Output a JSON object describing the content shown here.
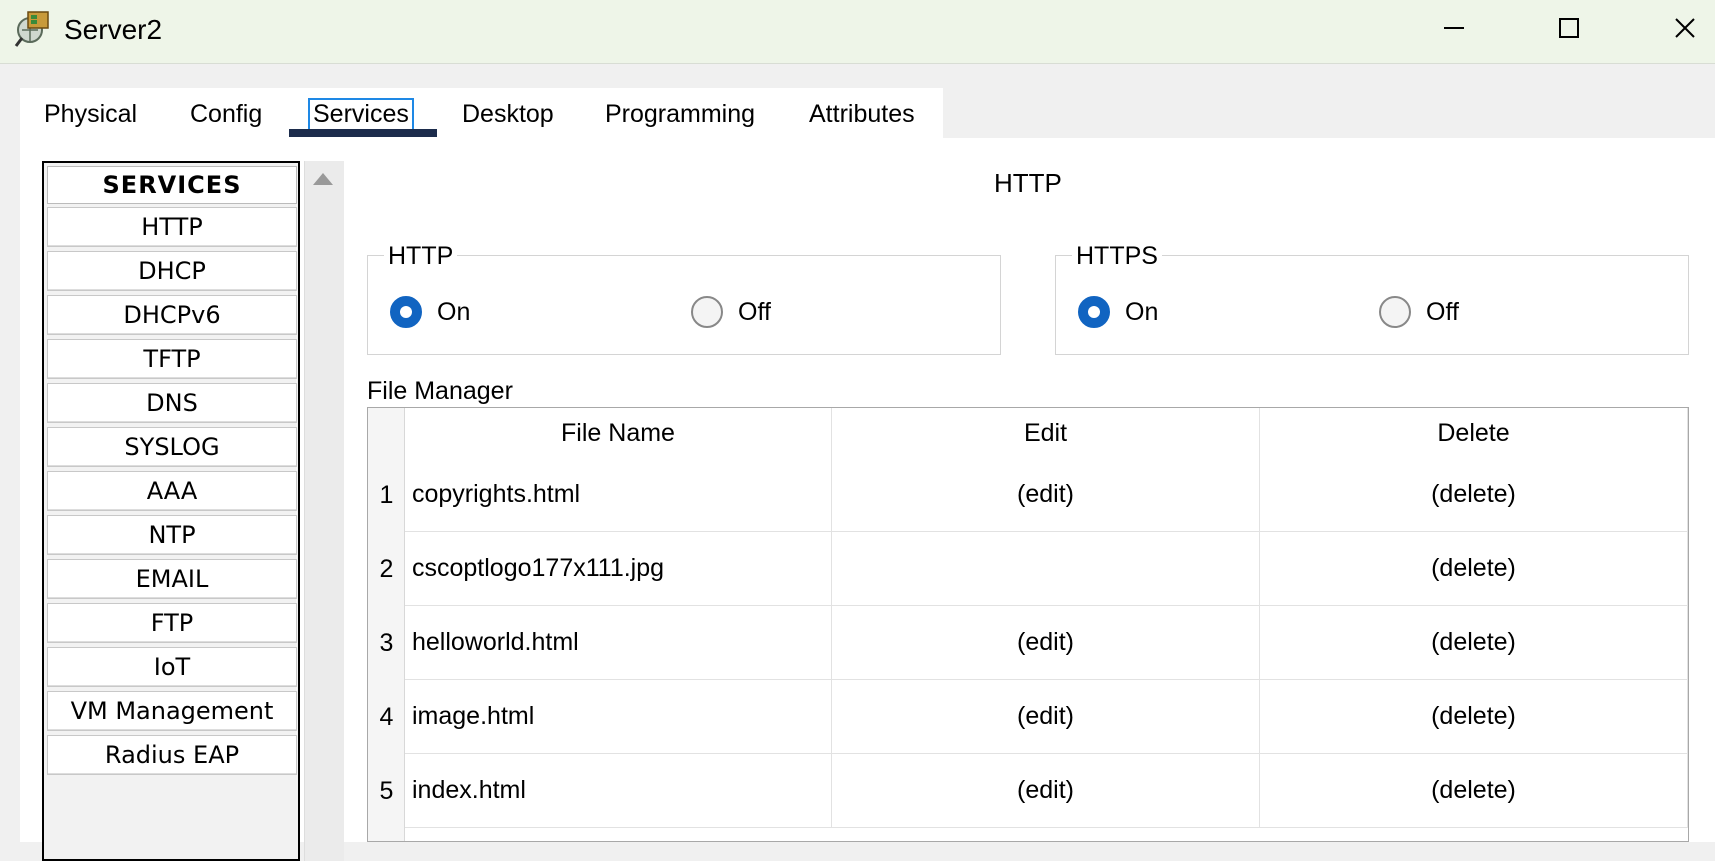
{
  "window": {
    "title": "Server2",
    "icon": "server-globe-icon"
  },
  "tabs": [
    {
      "label": "Physical",
      "active": false
    },
    {
      "label": "Config",
      "active": false
    },
    {
      "label": "Services",
      "active": true
    },
    {
      "label": "Desktop",
      "active": false
    },
    {
      "label": "Programming",
      "active": false
    },
    {
      "label": "Attributes",
      "active": false
    }
  ],
  "services": {
    "header": "SERVICES",
    "items": [
      "HTTP",
      "DHCP",
      "DHCPv6",
      "TFTP",
      "DNS",
      "SYSLOG",
      "AAA",
      "NTP",
      "EMAIL",
      "FTP",
      "IoT",
      "VM Management",
      "Radius EAP"
    ]
  },
  "main": {
    "title": "HTTP",
    "http": {
      "legend": "HTTP",
      "on_label": "On",
      "off_label": "Off",
      "selected": "On"
    },
    "https": {
      "legend": "HTTPS",
      "on_label": "On",
      "off_label": "Off",
      "selected": "On"
    },
    "file_manager": {
      "label": "File Manager",
      "columns": [
        "File Name",
        "Edit",
        "Delete"
      ],
      "rows": [
        {
          "num": "1",
          "name": "copyrights.html",
          "edit": "(edit)",
          "delete": "(delete)"
        },
        {
          "num": "2",
          "name": "cscoptlogo177x111.jpg",
          "edit": "",
          "delete": "(delete)"
        },
        {
          "num": "3",
          "name": "helloworld.html",
          "edit": "(edit)",
          "delete": "(delete)"
        },
        {
          "num": "4",
          "name": "image.html",
          "edit": "(edit)",
          "delete": "(delete)"
        },
        {
          "num": "5",
          "name": "index.html",
          "edit": "(edit)",
          "delete": "(delete)"
        }
      ]
    }
  },
  "colors": {
    "accent": "#1164c1",
    "tab_underline": "#1c2c4c",
    "titlebar": "#eef5e8"
  }
}
